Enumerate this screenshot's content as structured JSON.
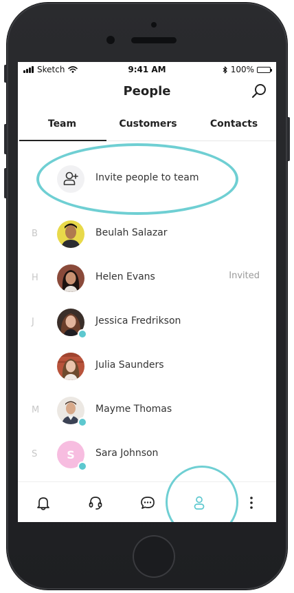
{
  "status_bar": {
    "carrier": "Sketch",
    "time": "9:41 AM",
    "battery": "100%"
  },
  "header": {
    "title": "People"
  },
  "tabs": [
    {
      "label": "Team",
      "selected": true
    },
    {
      "label": "Customers",
      "selected": false
    },
    {
      "label": "Contacts",
      "selected": false
    }
  ],
  "invite": {
    "label": "Invite people to team"
  },
  "people": [
    {
      "letter": "B",
      "name": "Beulah Salazar",
      "online": false,
      "tag": ""
    },
    {
      "letter": "H",
      "name": "Helen Evans",
      "online": false,
      "tag": "Invited"
    },
    {
      "letter": "J",
      "name": "Jessica Fredrikson",
      "online": true,
      "tag": ""
    },
    {
      "letter": "",
      "name": "Julia Saunders",
      "online": false,
      "tag": ""
    },
    {
      "letter": "M",
      "name": "Mayme Thomas",
      "online": true,
      "tag": ""
    },
    {
      "letter": "S",
      "name": "Sara Johnson",
      "online": true,
      "tag": "",
      "initial": "S"
    }
  ],
  "bottom_nav": [
    {
      "icon": "bell-icon",
      "active": false
    },
    {
      "icon": "headset-icon",
      "active": false
    },
    {
      "icon": "chat-icon",
      "active": false
    },
    {
      "icon": "person-icon",
      "active": true
    },
    {
      "icon": "more-vertical-icon",
      "active": false
    }
  ],
  "colors": {
    "accent": "#6fcfd3",
    "online": "#5dc8cf",
    "text": "#333333",
    "muted": "#999999"
  }
}
